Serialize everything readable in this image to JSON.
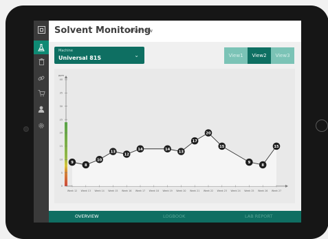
{
  "app": {
    "title": "Solvent Monitoring",
    "breadcrumb_separator": "›",
    "breadcrumb": "Overview"
  },
  "sidebar": {
    "items": [
      {
        "name": "logo",
        "icon": "app-logo-icon"
      },
      {
        "name": "flask",
        "icon": "flask-icon",
        "active": true
      },
      {
        "name": "trash",
        "icon": "trash-icon"
      },
      {
        "name": "link",
        "icon": "link-icon"
      },
      {
        "name": "cart",
        "icon": "cart-icon"
      },
      {
        "name": "user",
        "icon": "user-icon"
      },
      {
        "name": "settings",
        "icon": "gear-icon"
      }
    ]
  },
  "machine": {
    "label": "Machine",
    "value": "Universal 81S",
    "chevron": "⌄"
  },
  "views": [
    {
      "label": "View1",
      "active": false
    },
    {
      "label": "View2",
      "active": true
    },
    {
      "label": "View3",
      "active": false
    }
  ],
  "colors": {
    "accent": "#0e6f62",
    "accent_light": "#7bc3b6",
    "sidebar_bg": "#3a3a3a",
    "point": "#1e1e1e",
    "line": "#333333",
    "area": "#f5f5f5",
    "gradient": [
      "#e53b2a",
      "#f08b22",
      "#f3dc2a",
      "#9ccb3b",
      "#4fae3c"
    ]
  },
  "chart_data": {
    "type": "line",
    "ylabel": "ppm",
    "ylim": [
      0,
      40
    ],
    "yticks": [
      0,
      5,
      10,
      15,
      20,
      25,
      30,
      35,
      40
    ],
    "x": [
      "Week 12",
      "Week 13",
      "Week 14",
      "Week 15",
      "Week 16",
      "Week 17",
      "Week 18",
      "Week 19",
      "Week 20",
      "Week 21",
      "Week 22",
      "Week 23",
      "Week 24",
      "Week 25",
      "Week 26",
      "Week 27"
    ],
    "values": [
      9,
      8,
      10,
      13,
      12,
      14,
      null,
      14,
      13,
      17,
      20,
      15,
      null,
      9,
      8,
      15
    ],
    "grid": false
  },
  "bottom_nav": [
    {
      "label": "OVERVIEW",
      "active": true
    },
    {
      "label": "LOGBOOK",
      "active": false
    },
    {
      "label": "LAB REPORT",
      "active": false
    }
  ]
}
